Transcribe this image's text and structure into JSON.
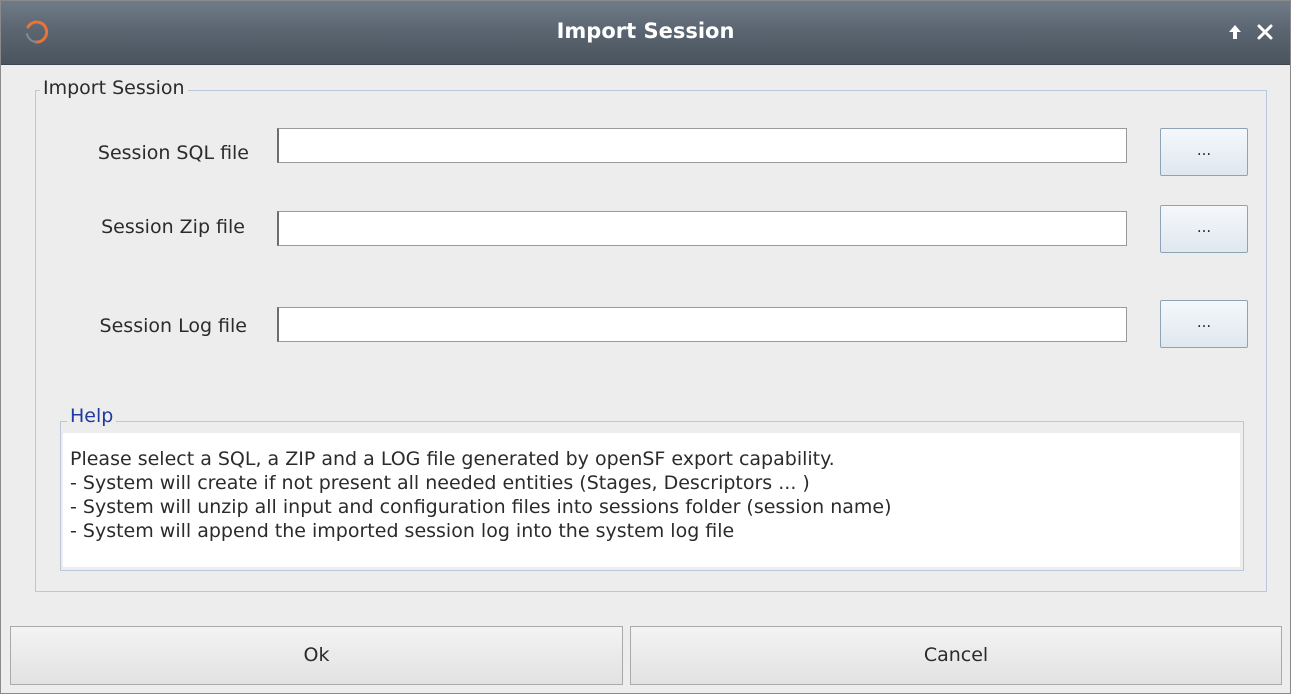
{
  "window": {
    "title": "Import Session",
    "keep_above_icon": "arrow-up-icon",
    "close_icon": "close-icon",
    "app_icon": "app-logo-icon"
  },
  "group": {
    "legend": "Import Session",
    "fields": [
      {
        "label": "Session SQL file",
        "value": "",
        "browse_label": "..."
      },
      {
        "label": "Session Zip file",
        "value": "",
        "browse_label": "..."
      },
      {
        "label": "Session Log file",
        "value": "",
        "browse_label": "..."
      }
    ]
  },
  "help": {
    "legend": "Help",
    "lines": [
      "Please select a SQL, a ZIP and a LOG file generated by openSF export capability.",
      "- System will create if not present all needed entities (Stages, Descriptors ... )",
      "- System will unzip all input and configuration files into sessions folder (session name)",
      "- System will append the imported session log into the system log file"
    ]
  },
  "buttons": {
    "ok_label": "Ok",
    "cancel_label": "Cancel"
  },
  "colors": {
    "titlebar": "#5b6672",
    "help_legend": "#1f3aa0",
    "group_border": "#b9c9da"
  }
}
